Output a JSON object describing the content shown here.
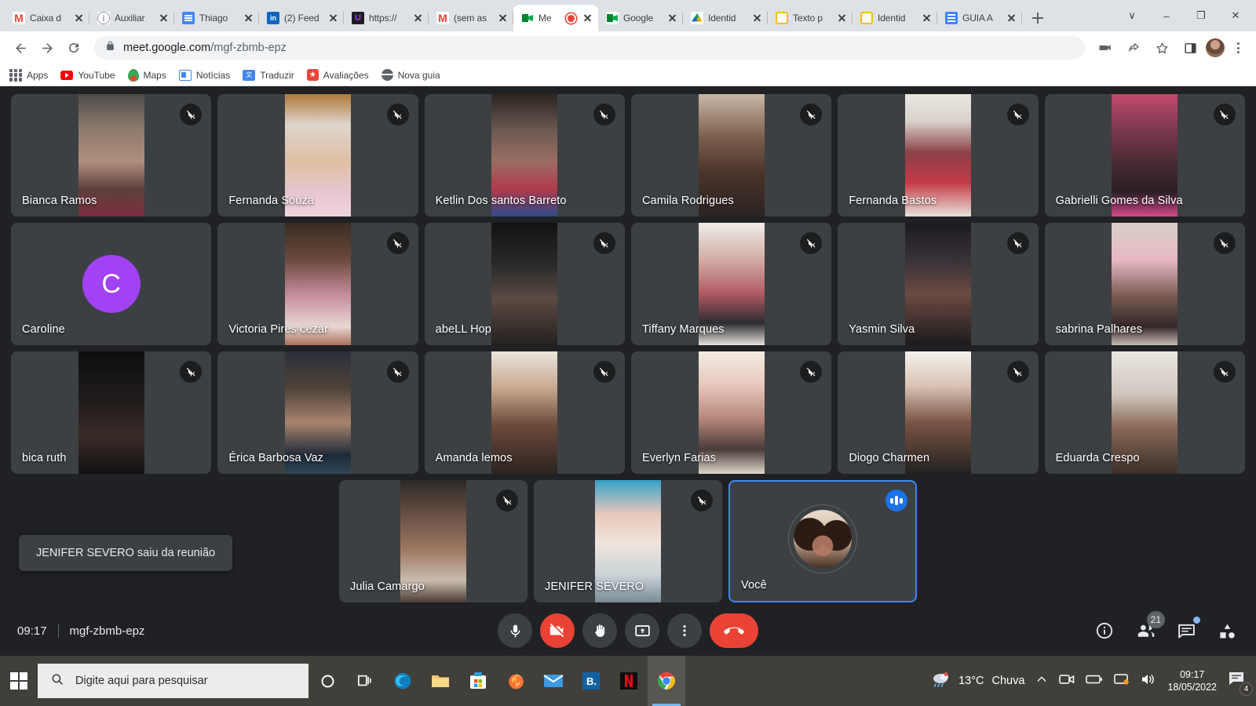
{
  "browser": {
    "tabs": [
      {
        "label": "Caixa d",
        "icon": "gmail-icon",
        "active": false,
        "recording": false
      },
      {
        "label": "Auxiliar",
        "icon": "info-icon",
        "active": false,
        "recording": false
      },
      {
        "label": "Thiago",
        "icon": "docs-icon",
        "active": false,
        "recording": false
      },
      {
        "label": "(2) Feed",
        "icon": "linkedin-icon",
        "active": false,
        "recording": false
      },
      {
        "label": "https://",
        "icon": "udemy-icon",
        "active": false,
        "recording": false
      },
      {
        "label": "(sem as",
        "icon": "gmail-icon",
        "active": false,
        "recording": false
      },
      {
        "label": "Me",
        "icon": "meet-icon",
        "active": true,
        "recording": true
      },
      {
        "label": "Google",
        "icon": "meet-icon",
        "active": false,
        "recording": false
      },
      {
        "label": "Identid",
        "icon": "drive-icon",
        "active": false,
        "recording": false
      },
      {
        "label": "Texto p",
        "icon": "note-icon",
        "active": false,
        "recording": false
      },
      {
        "label": "Identid",
        "icon": "note-icon",
        "active": false,
        "recording": false
      },
      {
        "label": "GUIA A",
        "icon": "docs-icon",
        "active": false,
        "recording": false
      }
    ],
    "new_tab_label": "+",
    "window_controls": {
      "minimize": "–",
      "maximize": "❐",
      "close": "✕",
      "tab_search": "∨"
    },
    "address": {
      "url_domain": "meet.google.com",
      "url_path": "/mgf-zbmb-epz",
      "lock": "lock-icon"
    },
    "bookmarks": [
      {
        "label": "Apps",
        "icon": "apps-grid-icon"
      },
      {
        "label": "YouTube",
        "icon": "youtube-icon"
      },
      {
        "label": "Maps",
        "icon": "maps-icon"
      },
      {
        "label": "Notícias",
        "icon": "news-icon"
      },
      {
        "label": "Traduzir",
        "icon": "translate-icon"
      },
      {
        "label": "Avaliações",
        "icon": "reviews-icon"
      },
      {
        "label": "Nova guia",
        "icon": "globe-icon"
      }
    ]
  },
  "meet": {
    "rows": [
      [
        {
          "name": "Bianca Ramos",
          "muted": true,
          "kind": "video",
          "v": "v1"
        },
        {
          "name": "Fernanda Souza",
          "muted": true,
          "kind": "video",
          "v": "v2"
        },
        {
          "name": "Ketlin Dos santos Barreto",
          "muted": true,
          "kind": "video",
          "v": "v3"
        },
        {
          "name": "Camila Rodrigues",
          "muted": true,
          "kind": "video",
          "v": "v4"
        },
        {
          "name": "Fernanda Bastos",
          "muted": true,
          "kind": "video",
          "v": "v5"
        },
        {
          "name": "Gabrielli Gomes da Silva",
          "muted": true,
          "kind": "video",
          "v": "v6"
        }
      ],
      [
        {
          "name": "Caroline",
          "muted": false,
          "kind": "avatar",
          "initial": "C",
          "avatar_color": "#a142f4"
        },
        {
          "name": "Victoria Pires cezar",
          "muted": true,
          "kind": "video",
          "v": "v7"
        },
        {
          "name": "abeLL Hop",
          "muted": true,
          "kind": "video",
          "v": "v8"
        },
        {
          "name": "Tiffany Marques",
          "muted": true,
          "kind": "video",
          "v": "v9"
        },
        {
          "name": "Yasmin Silva",
          "muted": true,
          "kind": "video",
          "v": "v10"
        },
        {
          "name": "sabrina Palhares",
          "muted": true,
          "kind": "video",
          "v": "v11"
        }
      ],
      [
        {
          "name": "bica ruth",
          "muted": true,
          "kind": "video",
          "v": "v12"
        },
        {
          "name": "Érica Barbosa Vaz",
          "muted": true,
          "kind": "video",
          "v": "v13"
        },
        {
          "name": "Amanda lemos",
          "muted": true,
          "kind": "video",
          "v": "v14"
        },
        {
          "name": "Everlyn Farias",
          "muted": true,
          "kind": "video",
          "v": "v15"
        },
        {
          "name": "Diogo Charmen",
          "muted": true,
          "kind": "video",
          "v": "v16"
        },
        {
          "name": "Eduarda Crespo",
          "muted": true,
          "kind": "video",
          "v": "v17"
        }
      ],
      [
        {
          "name": "Julia Camargo",
          "muted": true,
          "kind": "video",
          "v": "v18"
        },
        {
          "name": "JENIFER SEVERO",
          "muted": true,
          "kind": "video",
          "v": "v20"
        },
        {
          "name": "Você",
          "muted": false,
          "kind": "self",
          "speaking": true
        }
      ]
    ],
    "toast": "JENIFER SEVERO saiu da reunião",
    "bottom_bar": {
      "time": "09:17",
      "meeting_code": "mgf-zbmb-epz",
      "controls": [
        {
          "name": "microphone-button",
          "state": "on"
        },
        {
          "name": "camera-button",
          "state": "off"
        },
        {
          "name": "raise-hand-button",
          "state": "on"
        },
        {
          "name": "present-screen-button",
          "state": "on"
        },
        {
          "name": "more-options-button",
          "state": "on"
        },
        {
          "name": "leave-call-button",
          "state": "danger"
        }
      ],
      "participants_count": "21",
      "chat_has_unread": true
    },
    "accent_blue": "#1a73e8",
    "danger_red": "#ea4335"
  },
  "taskbar": {
    "search_placeholder": "Digite aqui para pesquisar",
    "apps": [
      "cortana-icon",
      "task-view-icon",
      "edge-icon",
      "file-explorer-icon",
      "microsoft-store-icon",
      "firefox-icon",
      "mail-icon",
      "booking-icon",
      "netflix-icon",
      "chrome-icon"
    ],
    "weather_temp": "13°C",
    "weather_text": "Chuva",
    "clock_time": "09:17",
    "clock_date": "18/05/2022",
    "notification_count": "4"
  }
}
